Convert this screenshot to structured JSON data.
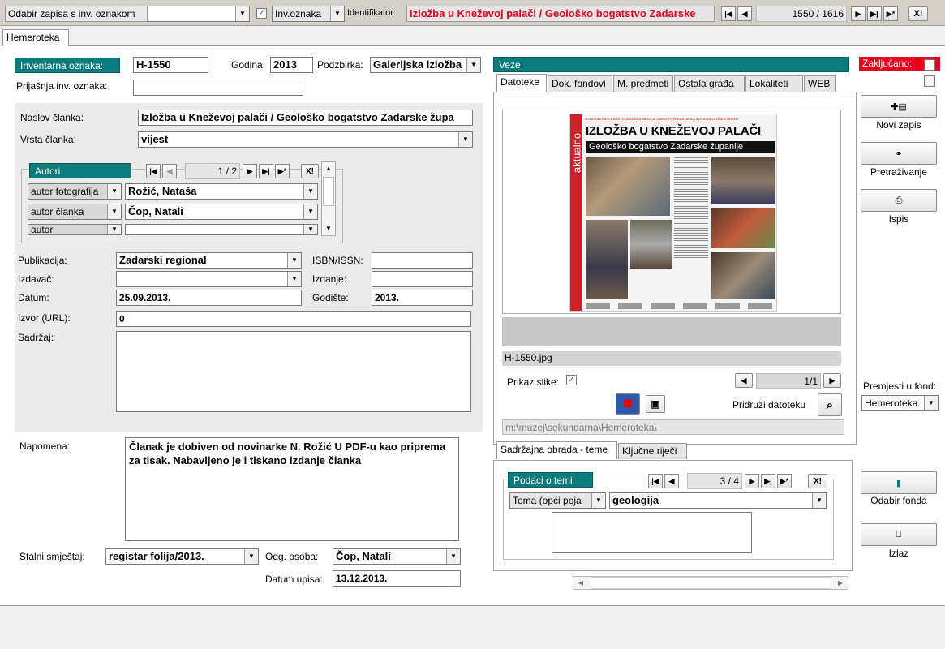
{
  "topbar": {
    "select_label": "Odabir zapisa s inv. oznakom",
    "select_value": "",
    "checkbox_label": "Inv.oznaka",
    "ident_label": "Identifikator:",
    "ident_value": "Izložba u Kneževoj palači / Geološko bogatstvo Zadarske",
    "record_counter": "1550 / 1616",
    "delete_label": "X!"
  },
  "main_tab": "Hemeroteka",
  "form": {
    "inv_label": "Inventarna oznaka:",
    "inv_value": "H-1550",
    "godina_label": "Godina:",
    "godina_value": "2013",
    "podzbirka_label": "Podzbirka:",
    "podzbirka_value": "Galerijska izložba",
    "prijasnja_label": "Prijašnja inv. oznaka:",
    "prijasnja_value": "",
    "naslov_label": "Naslov članka:",
    "naslov_value": "Izložba u Kneževoj palači / Geološko bogatstvo Zadarske župa",
    "vrsta_label": "Vrsta članka:",
    "vrsta_value": "vijest",
    "autori_title": "Autori",
    "autori_counter": "1 / 2",
    "autori": [
      {
        "role": "autor fotografija",
        "name": "Rožić, Nataša"
      },
      {
        "role": "autor članka",
        "name": "Čop, Natali"
      },
      {
        "role": "autor",
        "name": ""
      }
    ],
    "publikacija_label": "Publikacija:",
    "publikacija_value": "Zadarski regional",
    "isbn_label": "ISBN/ISSN:",
    "isbn_value": "",
    "izdavac_label": "Izdavač:",
    "izdavac_value": "",
    "izdanje_label": "Izdanje:",
    "izdanje_value": "",
    "datum_label": "Datum:",
    "datum_value": "25.09.2013.",
    "godiste_label": "Godište:",
    "godiste_value": "2013.",
    "izvor_label": "Izvor (URL):",
    "izvor_value": "0",
    "sadrzaj_label": "Sadržaj:",
    "sadrzaj_value": "",
    "napomena_label": "Napomena:",
    "napomena_value": "Članak je dobiven od novinarke N. Rožić U PDF-u kao priprema za tisak. Nabavljeno je i tiskano izdanje članka",
    "smjestaj_label": "Stalni smještaj:",
    "smjestaj_value": "registar folija/2013.",
    "osoba_label": "Odg. osoba:",
    "osoba_value": "Čop, Natali",
    "upis_label": "Datum upisa:",
    "upis_value": "13.12.2013."
  },
  "veze": {
    "title": "Veze",
    "tabs": [
      "Datoteke",
      "Dok. fondovi",
      "M. predmeti",
      "Ostala građa",
      "Lokaliteti",
      "WEB"
    ],
    "filename": "H-1550.jpg",
    "prikaz_label": "Prikaz slike:",
    "file_counter": "1/1",
    "pridruzi_label": "Pridruži datoteku",
    "path": "m:\\muzej\\sekundarna\\Hemeroteka\\",
    "newspaper_headline": "IZLOŽBA U KNEŽEVOJ PALAČI",
    "newspaper_subhead": "Geološko bogatstvo Zadarske županije",
    "newspaper_side": "aktualno",
    "newspaper_top": "OSNOVNA ŠKOLA BARTOLA KAŠIĆA ZBOG JE JAVNOSTI PREDSTAVILA SVOJU GEOLOŠKU ZBIRKU"
  },
  "teme": {
    "tabs": [
      "Sadržajna obrada - teme",
      "Ključne riječi"
    ],
    "title": "Podaci o temi",
    "counter": "3 / 4",
    "tema_type": "Tema (opći poja",
    "tema_value": "geologija"
  },
  "sidebar": {
    "zakljucano_label": "Zaključano:",
    "novi_zapis": "Novi zapis",
    "pretrazivanje": "Pretraživanje",
    "ispis": "Ispis",
    "premjesti_label": "Premjesti u fond:",
    "premjesti_value": "Hemeroteka",
    "odabir_fonda": "Odabir fonda",
    "izlaz": "Izlaz"
  },
  "colors": {
    "accent": "#0a7c7c",
    "ident_text": "#e8001c",
    "locked": "#e8001c"
  }
}
